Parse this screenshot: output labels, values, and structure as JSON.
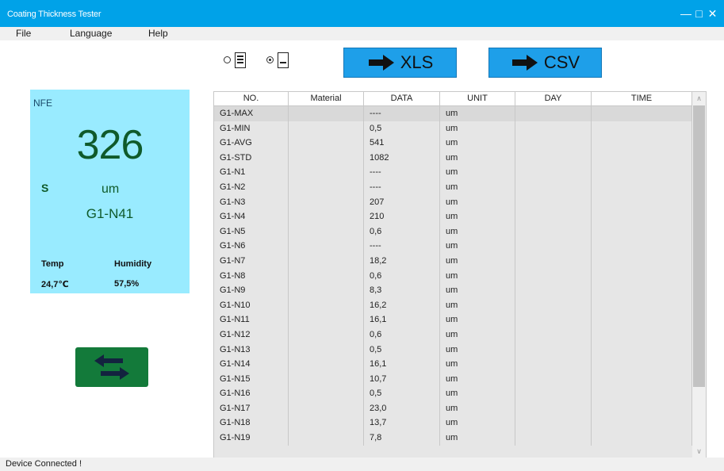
{
  "window": {
    "title": "Coating Thickness Tester"
  },
  "menu": {
    "items": [
      "File",
      "Language",
      "Help"
    ]
  },
  "toolbar": {
    "xls_label": "XLS",
    "csv_label": "CSV"
  },
  "reading": {
    "mode": "NFE",
    "value": "326",
    "s_label": "S",
    "unit": "um",
    "point": "G1-N41",
    "temp_label": "Temp",
    "humidity_label": "Humidity",
    "temp_value": "24,7℃",
    "humidity_value": "57,5%"
  },
  "table": {
    "columns": [
      "NO.",
      "Material",
      "DATA",
      "UNIT",
      "DAY",
      "TIME"
    ],
    "rows": [
      [
        "G1-MAX",
        "",
        "----",
        "um",
        "",
        ""
      ],
      [
        "G1-MIN",
        "",
        "0,5",
        "um",
        "",
        ""
      ],
      [
        "G1-AVG",
        "",
        "541",
        "um",
        "",
        ""
      ],
      [
        "G1-STD",
        "",
        "1082",
        "um",
        "",
        ""
      ],
      [
        "G1-N1",
        "",
        "----",
        "um",
        "",
        ""
      ],
      [
        "G1-N2",
        "",
        "----",
        "um",
        "",
        ""
      ],
      [
        "G1-N3",
        "",
        "207",
        "um",
        "",
        ""
      ],
      [
        "G1-N4",
        "",
        "210",
        "um",
        "",
        ""
      ],
      [
        "G1-N5",
        "",
        "0,6",
        "um",
        "",
        ""
      ],
      [
        "G1-N6",
        "",
        "----",
        "um",
        "",
        ""
      ],
      [
        "G1-N7",
        "",
        "18,2",
        "um",
        "",
        ""
      ],
      [
        "G1-N8",
        "",
        "0,6",
        "um",
        "",
        ""
      ],
      [
        "G1-N9",
        "",
        "8,3",
        "um",
        "",
        ""
      ],
      [
        "G1-N10",
        "",
        "16,2",
        "um",
        "",
        ""
      ],
      [
        "G1-N11",
        "",
        "16,1",
        "um",
        "",
        ""
      ],
      [
        "G1-N12",
        "",
        "0,6",
        "um",
        "",
        ""
      ],
      [
        "G1-N13",
        "",
        "0,5",
        "um",
        "",
        ""
      ],
      [
        "G1-N14",
        "",
        "16,1",
        "um",
        "",
        ""
      ],
      [
        "G1-N15",
        "",
        "10,7",
        "um",
        "",
        ""
      ],
      [
        "G1-N16",
        "",
        "0,5",
        "um",
        "",
        ""
      ],
      [
        "G1-N17",
        "",
        "23,0",
        "um",
        "",
        ""
      ],
      [
        "G1-N18",
        "",
        "13,7",
        "um",
        "",
        ""
      ],
      [
        "G1-N19",
        "",
        "7,8",
        "um",
        "",
        ""
      ]
    ]
  },
  "status": {
    "text": "Device Connected !"
  },
  "colors": {
    "titlebar": "#00a2e8",
    "export_button": "#1e9fe9",
    "reading_panel": "#99ebff",
    "reading_text": "#0f5a2a",
    "swap_button": "#137a3a"
  }
}
